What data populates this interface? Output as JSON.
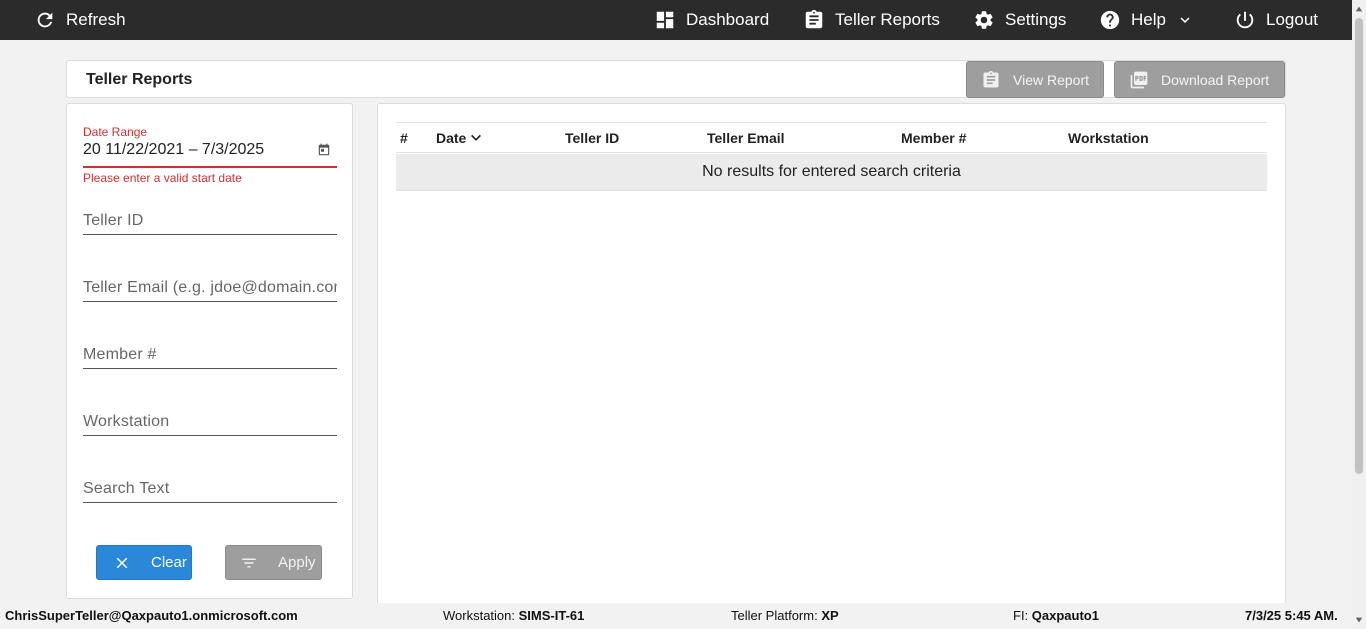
{
  "topbar": {
    "refresh_label": "Refresh",
    "nav": [
      {
        "label": "Dashboard",
        "icon": "dashboard-icon"
      },
      {
        "label": "Teller Reports",
        "icon": "clipboard-icon"
      },
      {
        "label": "Settings",
        "icon": "gear-icon"
      },
      {
        "label": "Help",
        "icon": "help-icon"
      },
      {
        "label": "Logout",
        "icon": "power-icon"
      }
    ]
  },
  "header": {
    "title": "Teller Reports",
    "view_report_label": "View Report",
    "download_report_label": "Download Report"
  },
  "filters": {
    "date_range_label": "Date Range",
    "date_range_value": "20 11/22/2021 – 7/3/2025",
    "date_error": "Please enter a valid start date",
    "teller_id_placeholder": "Teller ID",
    "teller_email_placeholder": "Teller Email (e.g. jdoe@domain.com)",
    "member_placeholder": "Member #",
    "workstation_placeholder": "Workstation",
    "search_text_placeholder": "Search Text",
    "clear_label": "Clear",
    "apply_label": "Apply"
  },
  "table": {
    "columns": [
      "#",
      "Date",
      "Teller ID",
      "Teller Email",
      "Member #",
      "Workstation"
    ],
    "sort_column": "Date",
    "empty_message": "No results for entered search criteria"
  },
  "status": {
    "user": "ChrisSuperTeller@Qaxpauto1.onmicrosoft.com",
    "workstation_label": "Workstation:",
    "workstation_value": "SIMS-IT-61",
    "platform_label": "Teller Platform:",
    "platform_value": "XP",
    "fi_label": "FI:",
    "fi_value": "Qaxpauto1",
    "datetime": "7/3/25 5:45 AM."
  },
  "colors": {
    "topbar": "#2b2b2b",
    "primary_button": "#2b88d8",
    "disabled_button": "#9e9e9e",
    "error": "#d32f2f"
  }
}
